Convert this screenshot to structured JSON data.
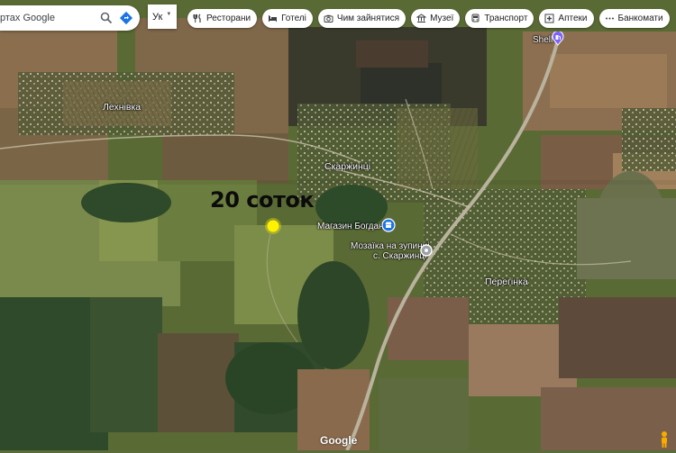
{
  "search": {
    "query_partial": "ртах Google"
  },
  "language": {
    "current": "Ук"
  },
  "chips": [
    {
      "label": "Ресторани",
      "icon": "fork-knife-icon"
    },
    {
      "label": "Готелі",
      "icon": "bed-icon"
    },
    {
      "label": "Чим зайнятися",
      "icon": "camera-icon"
    },
    {
      "label": "Музеї",
      "icon": "museum-icon"
    },
    {
      "label": "Транспорт",
      "icon": "bus-icon"
    },
    {
      "label": "Аптеки",
      "icon": "pharmacy-icon"
    },
    {
      "label": "Банкомати",
      "icon": "more-dots-icon"
    }
  ],
  "places": {
    "village_1": "Лехнівка",
    "village_2": "Скаржинці",
    "village_3": "Перегінка",
    "shop": "Магазин Богдан",
    "mosaic_line1": "Мозаїка на зупинці",
    "mosaic_line2": "с. Скаржинці",
    "gas": "Shell"
  },
  "annotation": {
    "text": "20 соток",
    "marker_color": "#fff200"
  },
  "colors": {
    "shop_pin": "#1a73e8",
    "poi_pin": "#9aa0a6",
    "gas_pin": "#7b61ff"
  },
  "branding": {
    "logo": "Google"
  }
}
